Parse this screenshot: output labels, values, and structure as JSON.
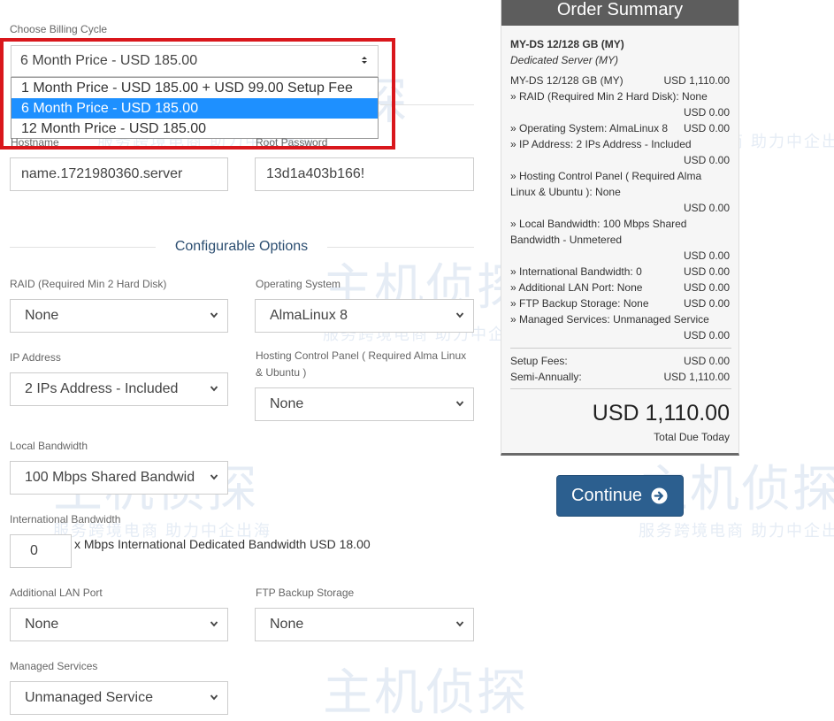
{
  "billing": {
    "label": "Choose Billing Cycle",
    "selected": "6 Month Price - USD 185.00",
    "options": [
      "1 Month Price - USD 185.00 + USD 99.00 Setup Fee",
      "6 Month Price - USD 185.00",
      "12 Month Price - USD 185.00"
    ]
  },
  "server": {
    "hostname_label": "Hostname",
    "hostname_value": "name.1721980360.server",
    "root_label": "Root Password",
    "root_value": "13d1a403b166!"
  },
  "config": {
    "title": "Configurable Options",
    "raid_label": "RAID (Required Min 2 Hard Disk)",
    "raid_value": "None",
    "os_label": "Operating System",
    "os_value": "AlmaLinux 8",
    "ip_label": "IP Address",
    "ip_value": "2 IPs Address - Included",
    "hcp_label": "Hosting Control Panel ( Required Alma Linux & Ubuntu )",
    "hcp_value": "None",
    "lb_label": "Local Bandwidth",
    "lb_value": "100 Mbps Shared Bandwid",
    "ib_label": "International Bandwidth",
    "ib_value": "0",
    "ib_text": "x Mbps International Dedicated Bandwidth USD 18.00",
    "lan_label": "Additional LAN Port",
    "lan_value": "None",
    "ftp_label": "FTP Backup Storage",
    "ftp_value": "None",
    "ms_label": "Managed Services",
    "ms_value": "Unmanaged Service"
  },
  "summary": {
    "title": "Order Summary",
    "product": "MY-DS 12/128 GB (MY)",
    "product_sub": "Dedicated Server (MY)",
    "lines": [
      {
        "text": "MY-DS 12/128 GB (MY)",
        "price": "USD 1,110.00"
      },
      {
        "text": "» RAID (Required Min 2 Hard Disk): None",
        "price": "USD 0.00"
      },
      {
        "text": "» Operating System: AlmaLinux 8",
        "price": "USD 0.00"
      },
      {
        "text": "» IP Address: 2 IPs Address - Included",
        "price": "USD 0.00"
      },
      {
        "text": "» Hosting Control Panel ( Required Alma",
        "text2": "Linux & Ubuntu ): None",
        "price": "USD 0.00"
      },
      {
        "text": "» Local Bandwidth: 100 Mbps Shared",
        "text2": "Bandwidth - Unmetered",
        "price": "USD 0.00"
      },
      {
        "text": "» International Bandwidth: 0",
        "price": "USD 0.00"
      },
      {
        "text": "» Additional LAN Port: None",
        "price": "USD 0.00"
      },
      {
        "text": "» FTP Backup Storage: None",
        "price": "USD 0.00"
      },
      {
        "text": "» Managed Services: Unmanaged Service",
        "price": "USD 0.00"
      }
    ],
    "setup_label": "Setup Fees:",
    "setup_value": "USD 0.00",
    "semi_label": "Semi-Annually:",
    "semi_value": "USD 1,110.00",
    "total": "USD 1,110.00",
    "total_label": "Total Due Today"
  },
  "continue_label": "Continue",
  "watermark": {
    "logo_text": "主机侦探",
    "slogan": "服务跨境电商  助力中企出海"
  },
  "colors": {
    "highlight_border": "#d9171c",
    "selected_option": "#1e90ff",
    "section_title": "#2c4e71",
    "continue_button": "#2c5f8f",
    "summary_header": "#5d5d5d"
  },
  "icons": [
    "chevron-down-icon",
    "arrow-right-circle-icon"
  ]
}
